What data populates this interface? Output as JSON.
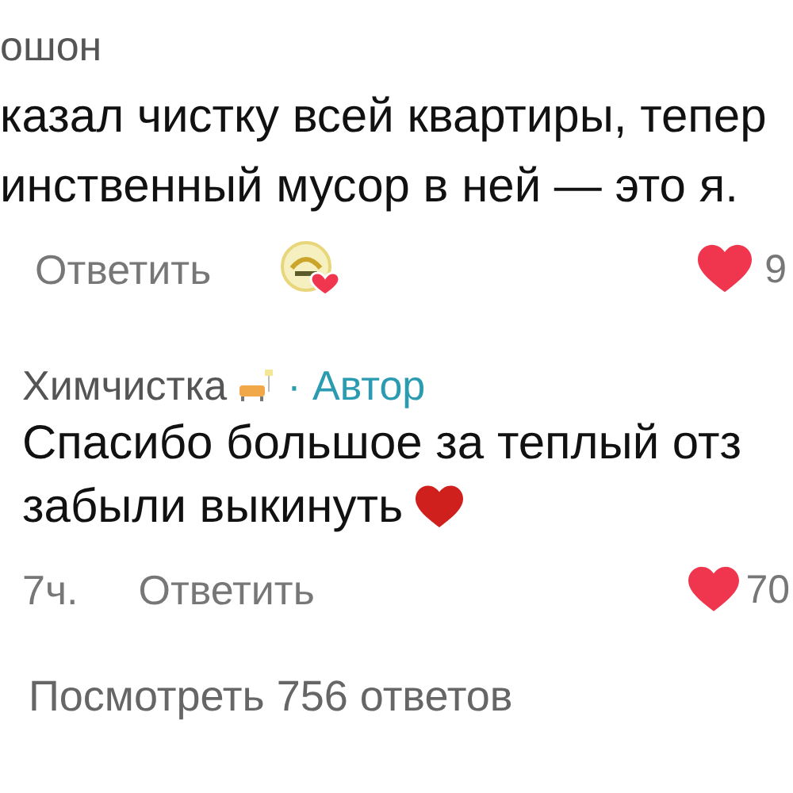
{
  "comment": {
    "author": "ошон",
    "lines": [
      "казал чистку всей квартиры, тепер",
      "инственный мусор в ней — это я."
    ],
    "reply_label": "Ответить",
    "liked": true,
    "likes": "9"
  },
  "reply": {
    "author": "Химчистка",
    "badge": "· Автор",
    "lines": [
      "Спасибо большое за теплый отз",
      "забыли выкинуть"
    ],
    "time": "7ч.",
    "reply_label": "Ответить",
    "liked": true,
    "likes": "70"
  },
  "view_replies": "Посмотреть 756 ответов"
}
